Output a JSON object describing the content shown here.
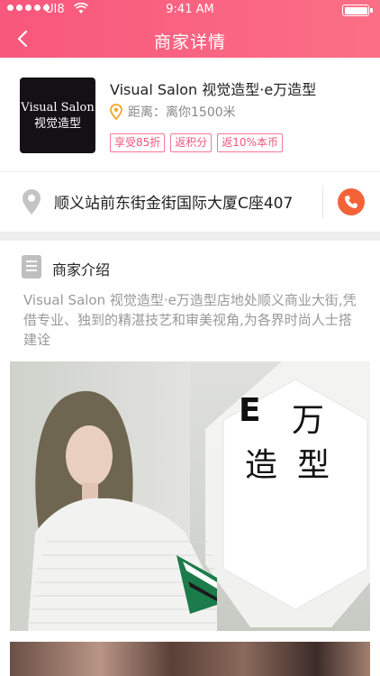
{
  "status_bar": {
    "carrier": "UI8",
    "time": "9:41 AM"
  },
  "nav": {
    "back_icon": "chevron-left-icon",
    "title": "商家详情"
  },
  "merchant": {
    "logo_text_line1": "Visual Salon",
    "logo_text_line2": "视觉造型",
    "name": "Visual Salon 视觉造型·e万造型",
    "distance_icon": "location-pin-icon",
    "distance": "距离：离你1500米",
    "tags": [
      "享受85折",
      "返积分",
      "返10%本币"
    ]
  },
  "address": {
    "icon": "location-pin-icon",
    "text": "顺义站前东街金街国际大厦C座407",
    "call_icon": "phone-icon"
  },
  "intro": {
    "icon": "document-icon",
    "title": "商家介绍",
    "text": "Visual Salon 视觉造型·e万造型店地处顺义商业大街,凭借专业、独到的精湛技艺和审美视角,为各界时尚人士搭建诠"
  },
  "photo_brand": {
    "e": "E",
    "wan": "万",
    "zaoxing": "造型"
  },
  "colors": {
    "header_start": "#f7577c",
    "header_end": "#fb6f86",
    "tag_border": "#f6789a",
    "tag_text": "#f2557b",
    "call_button": "#f46238",
    "location_orange": "#f5a623"
  }
}
